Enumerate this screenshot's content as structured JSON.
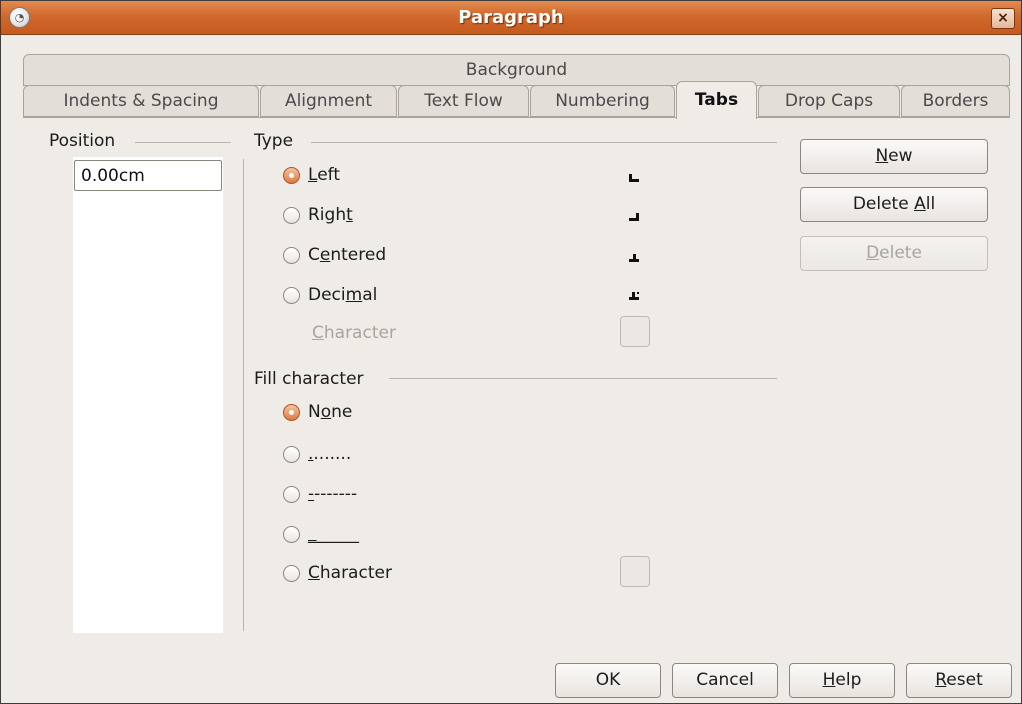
{
  "window": {
    "title": "Paragraph",
    "close_label": "×"
  },
  "top_tab": {
    "label": "Background"
  },
  "tabs": [
    {
      "label": "Indents & Spacing"
    },
    {
      "label": "Alignment"
    },
    {
      "label": "Text Flow"
    },
    {
      "label": "Numbering"
    },
    {
      "label": "Tabs"
    },
    {
      "label": "Drop Caps"
    },
    {
      "label": "Borders"
    }
  ],
  "position": {
    "label": "Position",
    "value": "0.00cm"
  },
  "type": {
    "label": "Type",
    "options": [
      {
        "pre": "",
        "u": "L",
        "post": "eft",
        "checked": true,
        "glyph": "tab-left-icon"
      },
      {
        "pre": "Righ",
        "u": "t",
        "post": "",
        "checked": false,
        "glyph": "tab-right-icon"
      },
      {
        "pre": "C",
        "u": "e",
        "post": "ntered",
        "checked": false,
        "glyph": "tab-centered-icon"
      },
      {
        "pre": "Deci",
        "u": "m",
        "post": "al",
        "checked": false,
        "glyph": "tab-decimal-icon"
      }
    ],
    "character": {
      "u": "C",
      "post": "haracter"
    }
  },
  "fill": {
    "label": "Fill character",
    "options": [
      {
        "pre": "N",
        "u": "o",
        "post": "ne",
        "checked": true
      },
      {
        "pre": "",
        "u": ".",
        "post": ".......",
        "checked": false
      },
      {
        "pre": "",
        "u": "-",
        "post": "-------",
        "checked": false
      },
      {
        "pre": "",
        "u": "_",
        "post": "_____",
        "checked": false
      },
      {
        "pre": "",
        "u": "C",
        "post": "haracter",
        "checked": false
      }
    ]
  },
  "side_buttons": {
    "new": {
      "u": "N",
      "post": "ew"
    },
    "delete_all": {
      "pre": "Delete ",
      "u": "A",
      "post": "ll"
    },
    "delete": {
      "u": "D",
      "post": "elete"
    }
  },
  "footer": {
    "ok": "OK",
    "cancel": "Cancel",
    "help": {
      "u": "H",
      "post": "elp"
    },
    "reset": {
      "u": "R",
      "post": "eset"
    }
  },
  "colors": {
    "titlebar": "#d1692c",
    "accent_radio": "#e07b3e",
    "dialog_bg": "#efebe7"
  }
}
